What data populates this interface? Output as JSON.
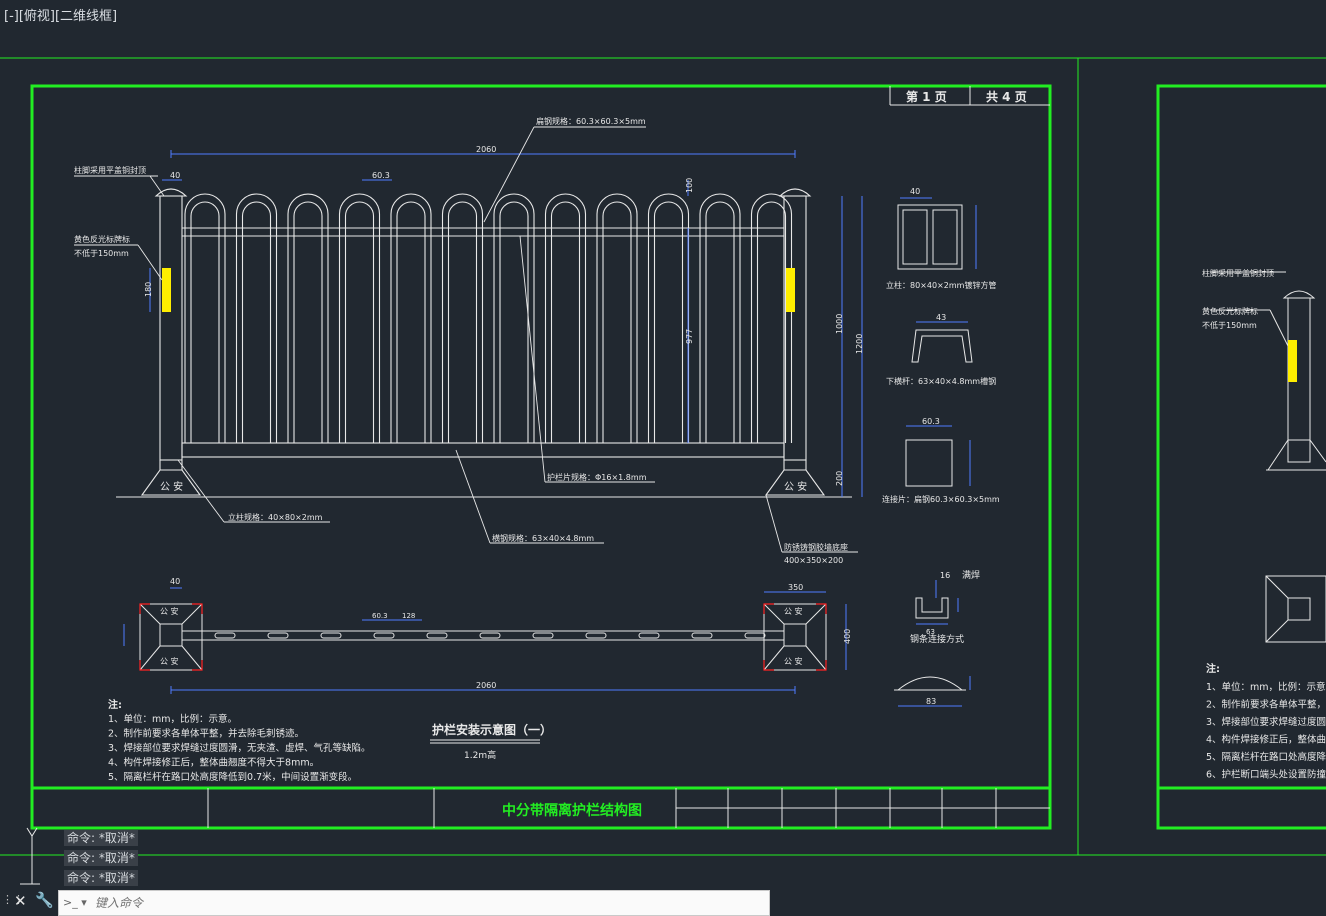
{
  "viewport": {
    "label": "[-][俯视][二维线框]"
  },
  "sheet": {
    "page_label": "第 1 页",
    "total_label": "共 4 页",
    "main_title": "中分带隔离护栏结构图",
    "figure_title": "护栏安装示意图（一）",
    "figure_sub": "1.2m高",
    "colors": {
      "frame": "#22ee22",
      "line": "#e8e8e8",
      "dim": "#4f7cff",
      "reflector": "#ffee00",
      "bg": "#212830"
    }
  },
  "annotations": {
    "top_rail": "扁钢规格：60.3×60.3×5mm",
    "post_cap": "柱脚采用平盖铜封顶",
    "reflector": "黄色反光标牌标",
    "reflector_min": "不低于150mm",
    "post_spec": "立柱规格：40×80×2mm",
    "fence_spec": "护栏片规格：Φ16×1.8mm",
    "bottom_rail": "横钢规格：63×40×4.8mm",
    "base_spec": "防锈铸钢胶墙底座",
    "base_size": "400×350×200",
    "col_a": "立柱：80×40×2mm镀锌方管",
    "col_b": "下横杆：63×40×4.8mm槽钢",
    "col_c": "连接片：扁钢60.3×60.3×5mm",
    "col_d": "钢条连接方式",
    "weld": "满焊",
    "base_text": "公 安"
  },
  "dimensions": {
    "total_len": "2060",
    "spacing": "60.3",
    "d_40": "40",
    "d_100": "100",
    "d_180": "180",
    "d_977": "977",
    "d_1000": "1000",
    "d_1200": "1200",
    "d_200": "200",
    "d_43": "43",
    "d_60_3": "60.3",
    "d_63": "63",
    "d_16": "16",
    "d_350": "350",
    "d_400": "400",
    "d_128": "128",
    "d_83": "83"
  },
  "notes": {
    "heading": "注:",
    "items": [
      "1、单位：mm，比例：示意。",
      "2、制作前要求各单体平整，并去除毛刺锈迹。",
      "3、焊接部位要求焊缝过度圆滑，无夹渣、虚焊、气孔等缺陷。",
      "4、构件焊接修正后，整体曲翘度不得大于8mm。",
      "5、隔离栏杆在路口处高度降低到0.7米，中间设置渐变段。"
    ],
    "items_right": [
      "1、单位：mm，比例：示意。",
      "2、制作前要求各单体平整，",
      "3、焊接部位要求焊缝过度圆",
      "4、构件焊接修正后，整体曲",
      "5、隔离栏杆在路口处高度降",
      "6、护栏断口端头处设置防撞"
    ]
  },
  "command": {
    "history": [
      "命令: *取消*",
      "命令: *取消*",
      "命令: *取消*"
    ],
    "placeholder": "键入命令"
  }
}
